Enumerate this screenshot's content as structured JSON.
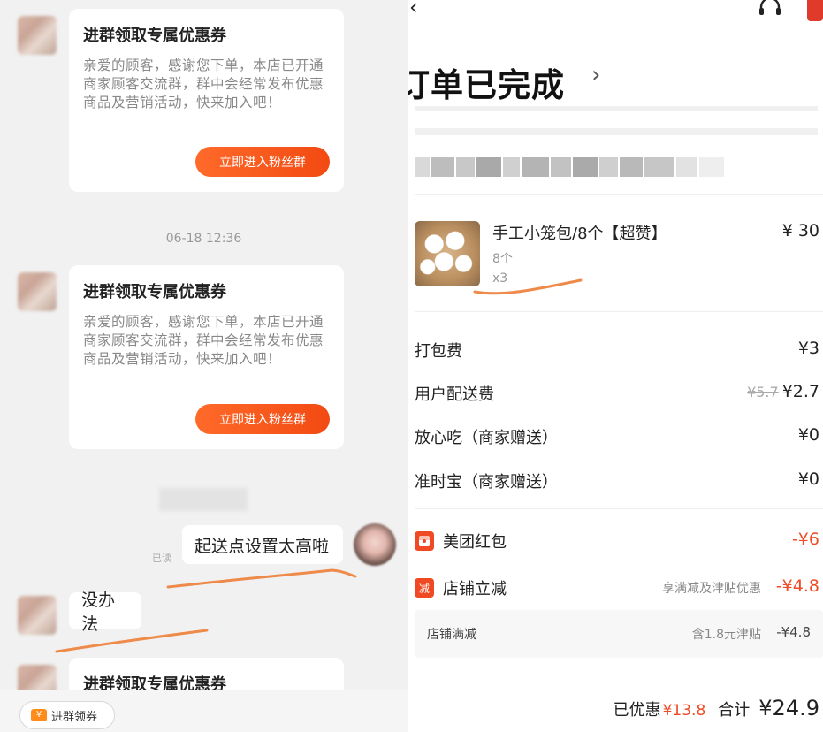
{
  "chat": {
    "cards": [
      {
        "title": "进群领取专属优惠券",
        "body": "亲爱的顾客，感谢您下单，本店已开通商家顾客交流群，群中会经常发布优惠商品及营销活动，快来加入吧！",
        "button": "立即进入粉丝群"
      },
      {
        "title": "进群领取专属优惠券",
        "body": "亲爱的顾客，感谢您下单，本店已开通商家顾客交流群，群中会经常发布优惠商品及营销活动，快来加入吧！",
        "button": "立即进入粉丝群"
      },
      {
        "title": "进群领取专属优惠券"
      }
    ],
    "timestamp": "06-18 12:36",
    "self_message": "起送点设置太高啦",
    "read_status": "已读",
    "merchant_reply": "没办法",
    "quick_button": "进群领券",
    "quick_button_icon": "coupon-icon"
  },
  "order": {
    "status_title": "订单已完成",
    "status_arrow": "›",
    "product": {
      "name": "手工小笼包/8个【超赞】",
      "price": "¥ 30",
      "spec": "8个",
      "qty": "x3"
    },
    "fees": [
      {
        "label": "打包费",
        "value": "¥3"
      },
      {
        "label": "用户配送费",
        "orig": "¥5.7",
        "value": "¥2.7"
      },
      {
        "label": "放心吃（商家赠送）",
        "value": "¥0"
      },
      {
        "label": "准时宝（商家赠送）",
        "value": "¥0"
      }
    ],
    "discounts": [
      {
        "icon": "红包",
        "label": "美团红包",
        "value": "-¥6"
      },
      {
        "icon": "减",
        "label": "店铺立减",
        "note": "享满减及津贴优惠",
        "value": "-¥4.8"
      }
    ],
    "sub_discount": {
      "label": "店铺满减",
      "note": "含1.8元津贴",
      "value": "-¥4.8"
    },
    "summary": {
      "saved_label": "已优惠",
      "saved_value": "¥13.8",
      "total_label": "合计",
      "total_value": "¥24.9"
    }
  },
  "colors": {
    "accent": "#f04a24",
    "button": "#f24a12",
    "chat_bg": "#f1f1f1",
    "scribble": "#ee8a4a"
  }
}
